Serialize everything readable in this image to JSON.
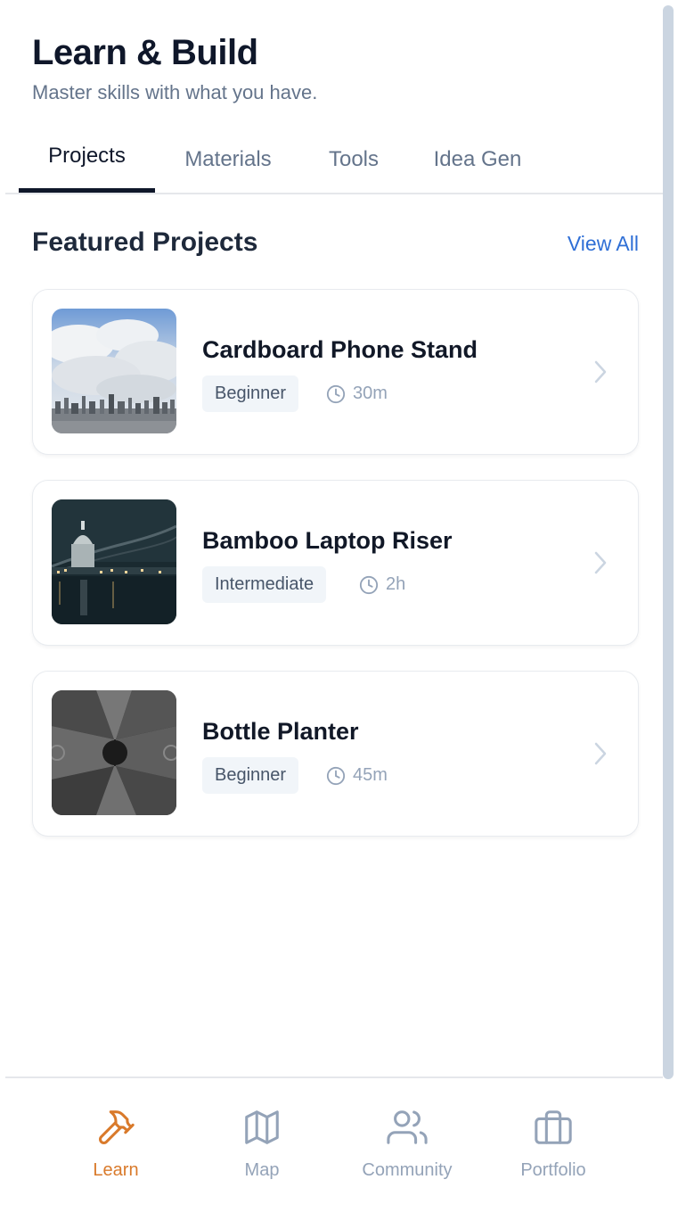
{
  "header": {
    "title": "Learn & Build",
    "subtitle": "Master skills with what you have."
  },
  "tabs": [
    {
      "label": "Projects",
      "active": true
    },
    {
      "label": "Materials",
      "active": false
    },
    {
      "label": "Tools",
      "active": false
    },
    {
      "label": "Idea Gen",
      "active": false
    }
  ],
  "section": {
    "title": "Featured Projects",
    "view_all": "View All"
  },
  "projects": [
    {
      "title": "Cardboard Phone Stand",
      "level": "Beginner",
      "duration": "30m",
      "thumbnail": "city-skyline-clouds"
    },
    {
      "title": "Bamboo Laptop Riser",
      "level": "Intermediate",
      "duration": "2h",
      "thumbnail": "night-cathedral-bridge"
    },
    {
      "title": "Bottle Planter",
      "level": "Beginner",
      "duration": "45m",
      "thumbnail": "building-looking-up-bw"
    }
  ],
  "nav": [
    {
      "label": "Learn",
      "icon": "hammer-icon",
      "active": true
    },
    {
      "label": "Map",
      "icon": "map-icon",
      "active": false
    },
    {
      "label": "Community",
      "icon": "users-icon",
      "active": false
    },
    {
      "label": "Portfolio",
      "icon": "briefcase-icon",
      "active": false
    }
  ],
  "colors": {
    "accent": "#d97a2b",
    "link": "#2f6fd6",
    "text_dark": "#0f172a",
    "muted": "#94a3b8"
  }
}
